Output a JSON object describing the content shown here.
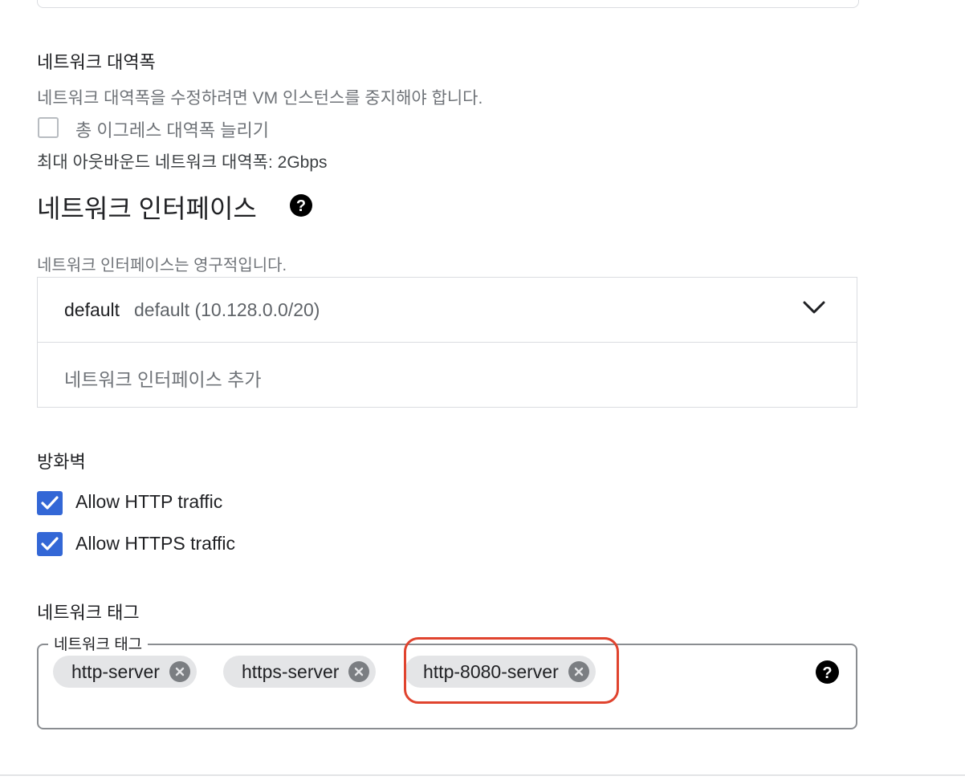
{
  "bandwidth": {
    "heading": "네트워크 대역폭",
    "helper": "네트워크 대역폭을 수정하려면 VM 인스턴스를 중지해야 합니다.",
    "egress_checkbox_label": "총 이그레스 대역폭 늘리기",
    "egress_checked": false,
    "max_outbound": "최대 아웃바운드 네트워크 대역폭: 2Gbps"
  },
  "network_interfaces": {
    "title": "네트워크 인터페이스",
    "help_icon": "help-circle-icon",
    "helper": "네트워크 인터페이스는 영구적입니다.",
    "interface": {
      "name": "default",
      "detail": "default (10.128.0.0/20)",
      "expand_icon": "chevron-down-icon"
    },
    "add_label": "네트워크 인터페이스 추가"
  },
  "firewall": {
    "heading": "방화벽",
    "options": [
      {
        "label": "Allow HTTP traffic",
        "checked": true
      },
      {
        "label": "Allow HTTPS traffic",
        "checked": true
      }
    ]
  },
  "network_tags": {
    "heading": "네트워크 태그",
    "field_label": "네트워크 태그",
    "tags": [
      "http-server",
      "https-server",
      "http-8080-server"
    ],
    "remove_icon": "cancel-circle-icon",
    "help_icon": "help-circle-icon"
  },
  "colors": {
    "checkbox_checked": "#3367d6",
    "highlight": "#e0432e",
    "chip_background": "#e4e5e7"
  }
}
